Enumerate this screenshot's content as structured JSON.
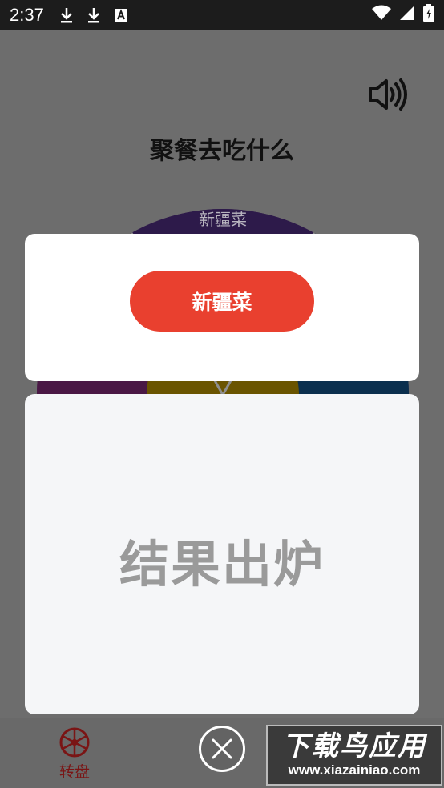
{
  "status_bar": {
    "time": "2:37",
    "icons": [
      "download-icon",
      "download-icon",
      "text-a-icon",
      "wifi-icon",
      "signal-icon",
      "battery-icon"
    ]
  },
  "app": {
    "title": "聚餐去吃什么",
    "wheel_top_label": "新疆菜",
    "sound_icon": "volume-icon"
  },
  "result_dialog": {
    "result_label": "新疆菜",
    "heading": "结果出炉"
  },
  "bottom_nav": {
    "items": [
      {
        "label": "转盘",
        "icon": "wheel-icon"
      }
    ]
  },
  "close_icon": "close-icon",
  "watermark": {
    "title": "下载鸟应用",
    "url": "www.xiazainiao.com"
  },
  "colors": {
    "accent": "#e9402f",
    "nav_active": "#7a1515",
    "wheel_segments": [
      "#2d1a4a",
      "#3a1f4f",
      "#0b2f4e",
      "#4f0d20",
      "#6a5400"
    ]
  }
}
